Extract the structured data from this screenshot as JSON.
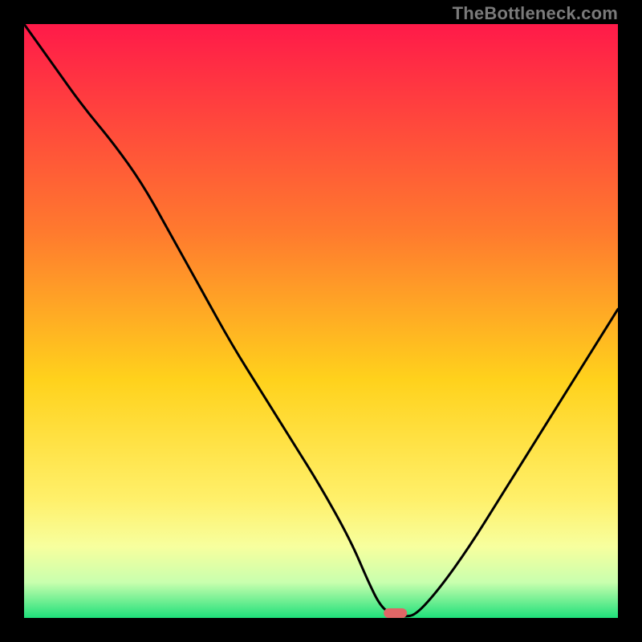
{
  "watermark": "TheBottleneck.com",
  "colors": {
    "top": "#ff1a49",
    "mid1": "#ff7a2e",
    "mid2": "#ffd21c",
    "mid3": "#fff06a",
    "mid4": "#f7ff9e",
    "mid5": "#c9ffae",
    "bottom": "#1fe07a",
    "marker": "#e06666",
    "curve": "#000000",
    "frame": "#000000"
  },
  "chart_data": {
    "type": "line",
    "title": "",
    "xlabel": "",
    "ylabel": "",
    "xlim": [
      0,
      100
    ],
    "ylim": [
      0,
      100
    ],
    "x": [
      0,
      5,
      10,
      15,
      20,
      25,
      30,
      35,
      40,
      45,
      50,
      55,
      58,
      60,
      62,
      64,
      66,
      70,
      75,
      80,
      85,
      90,
      95,
      100
    ],
    "values": [
      100,
      93,
      86,
      80,
      73,
      64,
      55,
      46,
      38,
      30,
      22,
      13,
      6,
      2,
      0.5,
      0.2,
      0.5,
      5,
      12,
      20,
      28,
      36,
      44,
      52
    ],
    "optimal_marker": {
      "x": 62.5,
      "width_pct": 4
    }
  }
}
